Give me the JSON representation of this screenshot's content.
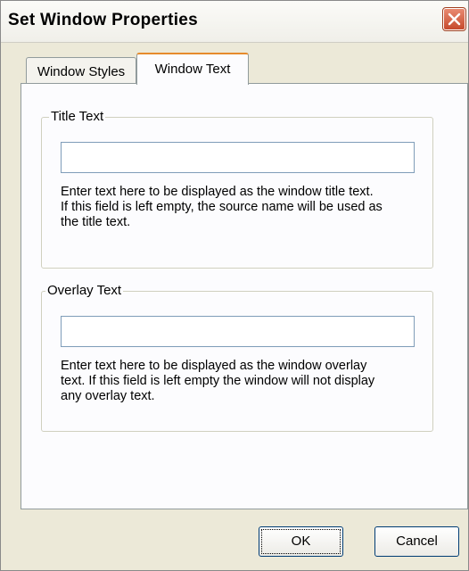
{
  "window": {
    "title": "Set Window Properties",
    "close_icon": "close-icon"
  },
  "tabs": [
    {
      "label": "Window Styles",
      "active": false
    },
    {
      "label": "Window Text",
      "active": true
    }
  ],
  "title_group": {
    "label": "Title Text",
    "value": "",
    "help": "Enter text here to be displayed as the window title text.\nIf this field is left empty, the source name will be used as\nthe title text."
  },
  "overlay_group": {
    "label": "Overlay Text",
    "value": "",
    "help": "Enter text here to be displayed as the window overlay\ntext. If this field is left empty the window will not display\nany overlay text."
  },
  "buttons": {
    "ok": "OK",
    "cancel": "Cancel"
  },
  "colors": {
    "dialog_bg": "#ece9d8",
    "panel_bg": "#fcfcfe",
    "active_tab_accent": "#e68b2c",
    "close_button": "#c64a2d"
  }
}
